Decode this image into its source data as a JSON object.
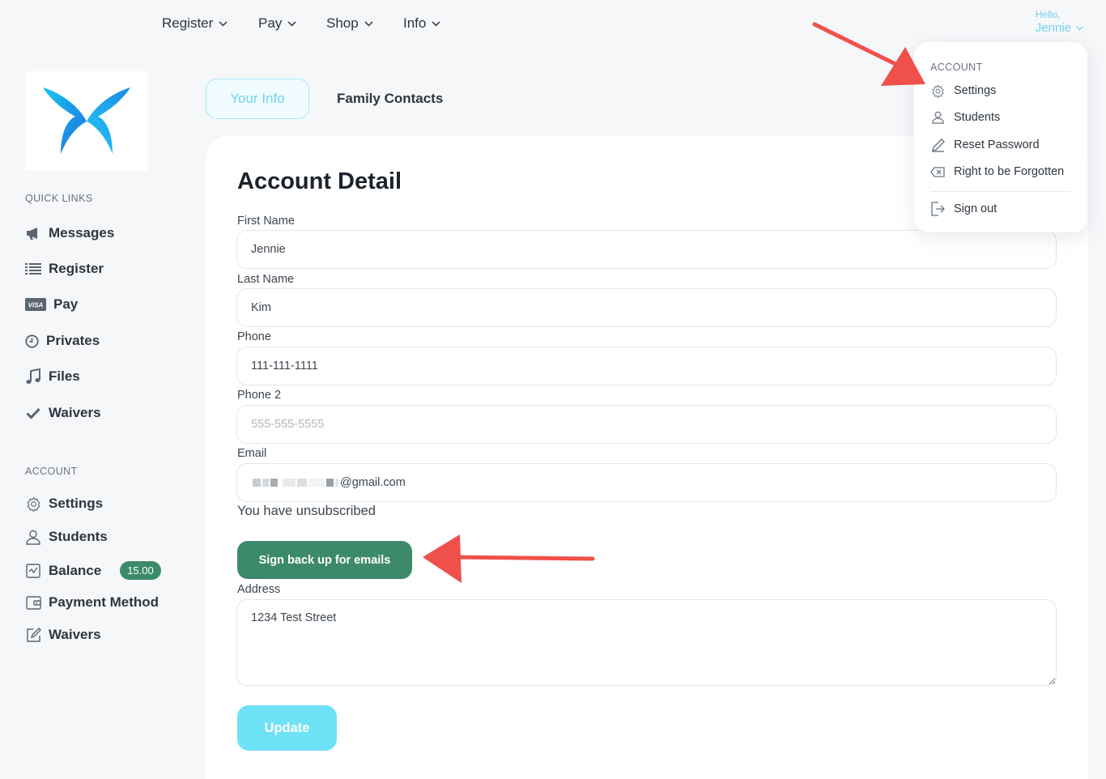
{
  "topnav": {
    "items": [
      {
        "label": "Register"
      },
      {
        "label": "Pay"
      },
      {
        "label": "Shop"
      },
      {
        "label": "Info"
      }
    ],
    "greeting": "Hello,",
    "user_name": "Jennie"
  },
  "sidebar": {
    "quick_links_heading": "QUICK LINKS",
    "quick_links": [
      {
        "label": "Messages",
        "icon": "megaphone-icon"
      },
      {
        "label": "Register",
        "icon": "list-icon"
      },
      {
        "label": "Pay",
        "icon": "visa-card-icon"
      },
      {
        "label": "Privates",
        "icon": "clock-icon"
      },
      {
        "label": "Files",
        "icon": "music-note-icon"
      },
      {
        "label": "Waivers",
        "icon": "checkmark-icon"
      }
    ],
    "account_heading": "ACCOUNT",
    "account_links": [
      {
        "label": "Settings",
        "icon": "gear-icon"
      },
      {
        "label": "Students",
        "icon": "user-icon"
      },
      {
        "label": "Balance",
        "icon": "chart-box-icon",
        "badge": "15.00"
      },
      {
        "label": "Payment Method",
        "icon": "wallet-icon"
      },
      {
        "label": "Waivers",
        "icon": "edit-icon"
      }
    ]
  },
  "tabs": [
    {
      "label": "Your Info",
      "active": true
    },
    {
      "label": "Family Contacts",
      "active": false
    }
  ],
  "form": {
    "title": "Account Detail",
    "first_name_label": "First Name",
    "first_name_value": "Jennie",
    "last_name_label": "Last Name",
    "last_name_value": "Kim",
    "phone_label": "Phone",
    "phone_value": "111-111-1111",
    "phone2_label": "Phone 2",
    "phone2_placeholder": "555-555-5555",
    "email_label": "Email",
    "email_visible_value": "@gmail.com",
    "unsubscribed_text": "You have unsubscribed",
    "resubscribe_button": "Sign back up for emails",
    "address_label": "Address",
    "address_value": "1234 Test Street",
    "update_button": "Update"
  },
  "dropdown": {
    "heading": "ACCOUNT",
    "items": [
      {
        "label": "Settings",
        "icon": "gear-icon"
      },
      {
        "label": "Students",
        "icon": "user-icon"
      },
      {
        "label": "Reset Password",
        "icon": "pencil-icon"
      },
      {
        "label": "Right to be Forgotten",
        "icon": "erase-icon"
      },
      {
        "label": "Sign out",
        "icon": "sign-out-icon"
      }
    ]
  },
  "colors": {
    "accent_cyan": "#6fd3ea",
    "button_green": "#3d8a6b",
    "update_button": "#6ee2f6",
    "annotation_arrow": "#f0504a",
    "page_background": "#f5f7f9"
  }
}
